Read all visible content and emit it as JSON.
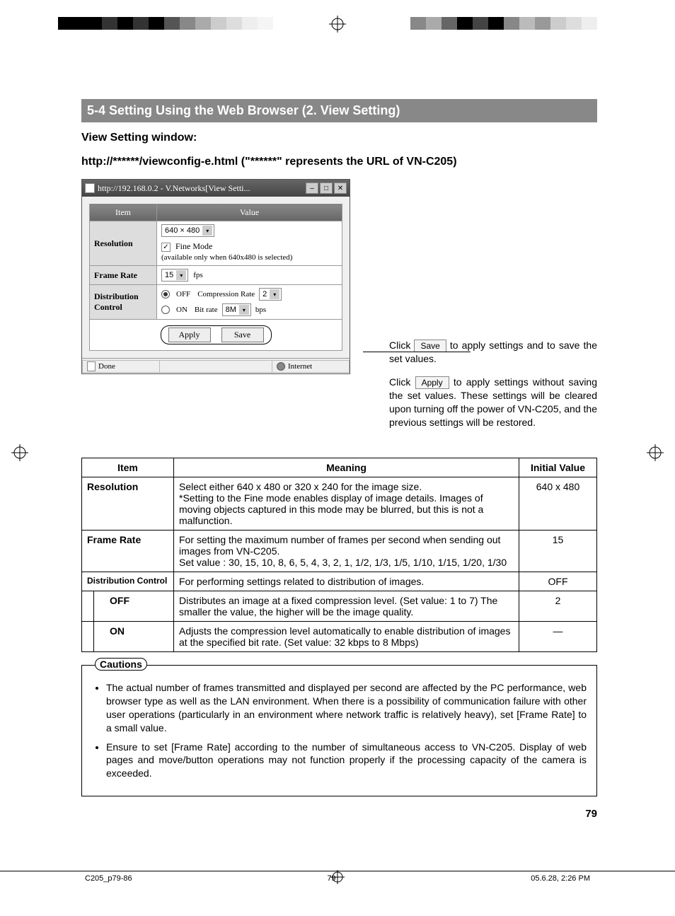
{
  "section_title": "5-4 Setting Using the Web Browser (2. View Setting)",
  "subhead_1": "View Setting window:",
  "subhead_2": "http://******/viewconfig-e.html (\"******\" represents the URL of VN-C205)",
  "browser": {
    "title": "http://192.168.0.2 - V.Networks[View Setti...",
    "columns": {
      "item": "Item",
      "value": "Value"
    },
    "rows": {
      "resolution": {
        "label": "Resolution",
        "select_value": "640 × 480",
        "fine_mode_label": "Fine Mode",
        "fine_mode_note": "(available only when 640x480 is selected)"
      },
      "frame_rate": {
        "label": "Frame Rate",
        "select_value": "15",
        "unit": "fps"
      },
      "distribution": {
        "label": "Distribution Control",
        "off_label": "OFF",
        "on_label": "ON",
        "compression_label": "Compression Rate",
        "compression_value": "2",
        "bitrate_label": "Bit rate",
        "bitrate_value": "8M",
        "bitrate_unit": "bps"
      }
    },
    "apply_btn": "Apply",
    "save_btn": "Save",
    "status_done": "Done",
    "status_zone": "Internet"
  },
  "callouts": {
    "save_pre": "Click ",
    "save_btn": "Save",
    "save_post": " to apply settings and to save the set values.",
    "apply_pre": "Click ",
    "apply_btn": "Apply",
    "apply_post": " to apply settings without saving the set values. These settings will be cleared upon turning off the power of VN-C205, and the previous settings will be restored."
  },
  "table": {
    "headers": {
      "item": "Item",
      "meaning": "Meaning",
      "initial": "Initial Value"
    },
    "rows": [
      {
        "item": "Resolution",
        "meaning": "Select either 640 x 480 or 320 x 240 for the image size.\n*Setting to the Fine mode enables display of image details. Images of moving objects captured in this mode may be blurred, but this is not a malfunction.",
        "initial": "640 x 480"
      },
      {
        "item": "Frame Rate",
        "meaning": "For setting the maximum number of frames per second when sending out images from VN-C205.\nSet value : 30, 15, 10, 8, 6, 5, 4, 3, 2, 1, 1/2, 1/3, 1/5, 1/10, 1/15, 1/20, 1/30",
        "initial": "15"
      },
      {
        "item": "Distribution Control",
        "meaning": "For performing settings related to distribution of images.",
        "initial": "OFF"
      },
      {
        "sub": true,
        "item": "OFF",
        "meaning": "Distributes an image at a fixed compression level. (Set value: 1 to 7) The smaller the value, the higher will be the image quality.",
        "initial": "2"
      },
      {
        "sub": true,
        "item": "ON",
        "meaning": "Adjusts the compression level automatically to enable distribution of images at the specified bit rate. (Set value: 32 kbps to 8 Mbps)",
        "initial": "—"
      }
    ]
  },
  "cautions": {
    "label": "Cautions",
    "items": [
      "The actual number of frames transmitted and displayed per second are affected by the PC performance, web browser type as well as the LAN environment. When there is a possibility of communication failure with other user operations (particularly in an environment where network traffic is relatively heavy), set [Frame Rate] to a small value.",
      "Ensure to set [Frame Rate] according to the number of simultaneous access to VN-C205. Display of web pages and move/button operations may not function properly if the processing capacity of the camera is exceeded."
    ]
  },
  "page_number": "79",
  "footer": {
    "left": "C205_p79-86",
    "center": "79",
    "right": "05.6.28, 2:26 PM"
  }
}
